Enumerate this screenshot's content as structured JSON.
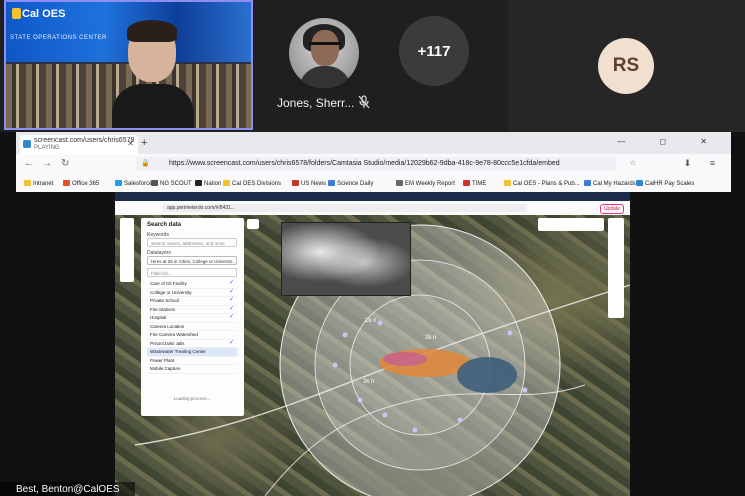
{
  "meeting": {
    "self_tile": {
      "logo_text": "Cal OES",
      "wall_text": "STATE OPERATIONS CENTER"
    },
    "participants": [
      {
        "name": "Jones, Sherr...",
        "muted": true
      }
    ],
    "overflow_count": "+117",
    "initials_tile": {
      "initials": "RS",
      "color": "#f1dfcf"
    },
    "presenter_label": "Best, Benton@CalOES"
  },
  "browser": {
    "tab": {
      "title": "screencast.com/users/chris6578",
      "subtitle": "PLAYING",
      "close": "✕"
    },
    "new_tab": "+",
    "window_controls": "—  ◻  ✕",
    "nav": {
      "back": "←",
      "forward": "→",
      "reload": "↻"
    },
    "url": "https://www.screencast.com/users/chris6578/folders/Camtasia Studio/media/12029b62-9dba-418c-9e78-80ccc5e1cfda/embed",
    "bookmarks": [
      {
        "label": "Intranet",
        "color": "#f2c12e"
      },
      {
        "label": "Office 365",
        "color": "#e84f2a"
      },
      {
        "label": "Salesforce",
        "color": "#1ea0e4"
      },
      {
        "label": "NG SCOUT",
        "color": "#555555"
      },
      {
        "label": "Nation",
        "color": "#222222"
      },
      {
        "label": "Cal OES Divisions",
        "color": "#f2c12e"
      },
      {
        "label": "US News",
        "color": "#c0392b"
      },
      {
        "label": "Science Daily",
        "color": "#3a7bd5"
      },
      {
        "label": "EM Weekly Report",
        "color": "#666666"
      },
      {
        "label": "TIME",
        "color": "#d0312d"
      },
      {
        "label": "Cal OES - Plans & Pub...",
        "color": "#f2c12e"
      },
      {
        "label": "Cal My Hazards",
        "color": "#3a7bd5"
      },
      {
        "label": "CalHR Pay Scales",
        "color": "#2b87ce"
      }
    ]
  },
  "inner_app": {
    "url": "app.perimeterdo.com/#/8431...",
    "update_label": "Update",
    "panel": {
      "title": "Search data",
      "keywords_label": "Keywords",
      "search_placeholder": "Search names, addresses, and more",
      "layers_label": "Datalayers",
      "layer_select": "Hires at 25 in Cities, College or Universit...",
      "filter_placeholder": "Filter list...",
      "layers": [
        {
          "label": "Care of Oil Facility",
          "checked": true
        },
        {
          "label": "College or University",
          "checked": true
        },
        {
          "label": "Private School",
          "checked": true
        },
        {
          "label": "Fire Stations",
          "checked": true
        },
        {
          "label": "Hospital",
          "checked": true
        },
        {
          "label": "Camera Location",
          "checked": false
        },
        {
          "label": "Fire Camera Watershed",
          "checked": false
        },
        {
          "label": "Prison/Jails/ Jails",
          "checked": true
        },
        {
          "label": "Wastewater Treating Center",
          "checked": false
        },
        {
          "label": "Power Plant",
          "checked": false
        },
        {
          "label": "Mobile Capture",
          "checked": false
        }
      ],
      "loading_text": "Loading process..."
    },
    "map_labels": [
      "1k n",
      "2k n",
      "3k n"
    ]
  }
}
